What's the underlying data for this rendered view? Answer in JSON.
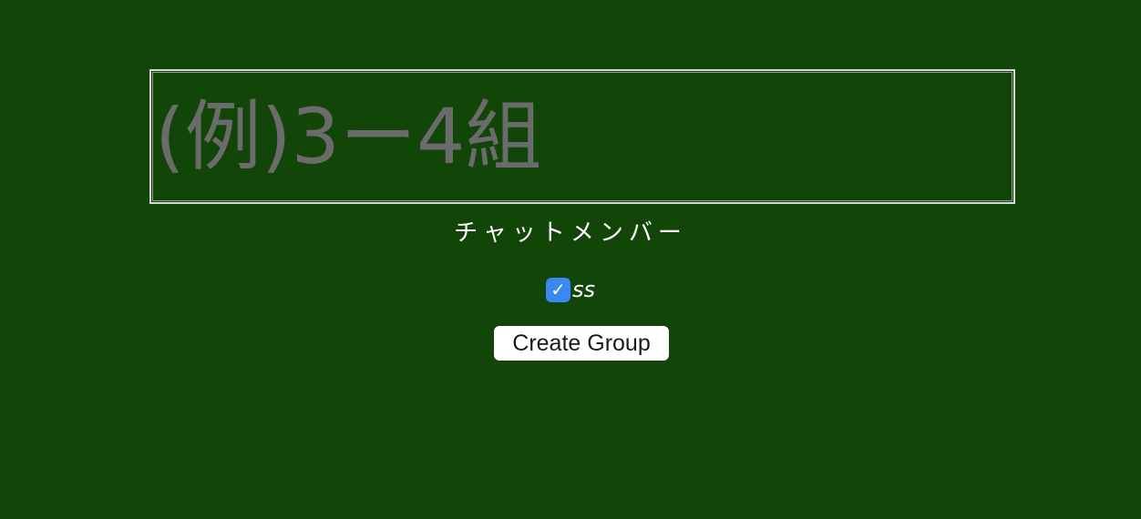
{
  "group_name_input": {
    "placeholder": "(例)3ー4組",
    "value": ""
  },
  "members": {
    "title": "チャットメンバー",
    "list": [
      {
        "name": "ss",
        "checked": true,
        "check_glyph": "✓"
      }
    ]
  },
  "create_button": {
    "label": "Create Group"
  },
  "colors": {
    "background": "#124508",
    "checkbox_accent": "#3b87f3",
    "placeholder_text": "#6b6b6b",
    "text": "#ffffff"
  }
}
